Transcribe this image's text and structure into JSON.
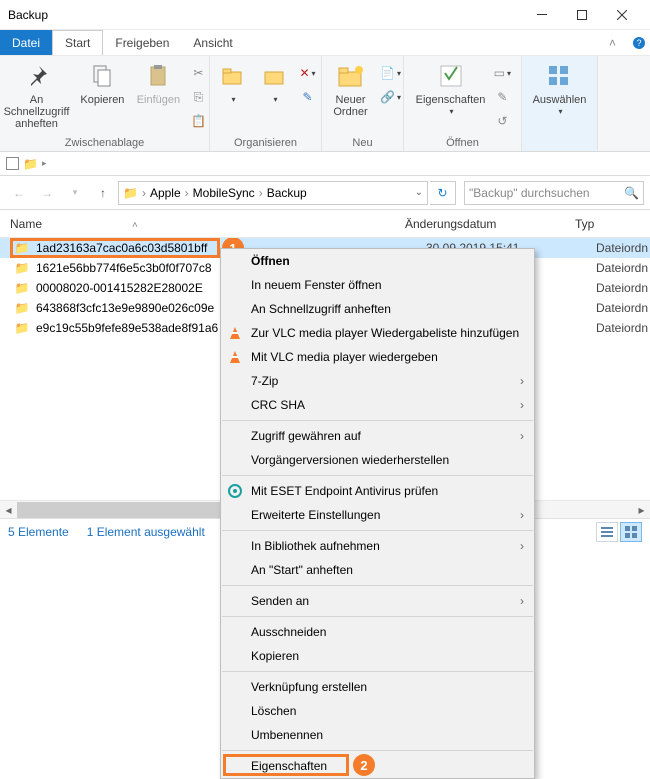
{
  "window": {
    "title": "Backup"
  },
  "menubar": {
    "file": "Datei",
    "tabs": [
      "Start",
      "Freigeben",
      "Ansicht"
    ]
  },
  "ribbon": {
    "groups": [
      {
        "label": "Zwischenablage",
        "buttons": [
          {
            "label": "An Schnellzugriff\nanheften",
            "icon": "pin-icon",
            "dim": false
          },
          {
            "label": "Kopieren",
            "icon": "copy-icon",
            "dim": false
          },
          {
            "label": "Einfügen",
            "icon": "paste-icon",
            "dim": true
          }
        ]
      },
      {
        "label": "Organisieren",
        "buttons": [
          {
            "label": "",
            "icon": "moveto-icon"
          },
          {
            "label": "",
            "icon": "delete-icon"
          }
        ]
      },
      {
        "label": "Neu",
        "buttons": [
          {
            "label": "Neuer\nOrdner",
            "icon": "new-folder-icon"
          }
        ]
      },
      {
        "label": "Öffnen",
        "buttons": [
          {
            "label": "Eigenschaften",
            "icon": "properties-icon"
          }
        ]
      },
      {
        "label": "",
        "buttons": [
          {
            "label": "Auswählen",
            "icon": "select-icon"
          }
        ]
      }
    ]
  },
  "breadcrumb": {
    "parts": [
      "Apple",
      "MobileSync",
      "Backup"
    ]
  },
  "search": {
    "placeholder": "\"Backup\" durchsuchen"
  },
  "columns": {
    "name": "Name",
    "date": "Änderungsdatum",
    "type": "Typ"
  },
  "rows": [
    {
      "name": "1ad23163a7cac0a6c03d5801bff",
      "date": "30.09.2019 15:41",
      "type": "Dateiordn"
    },
    {
      "name": "1621e56bb774f6e5c3b0f0f707c8",
      "date": "",
      "type": "Dateiordn"
    },
    {
      "name": "00008020-001415282E28002E",
      "date": "",
      "type": "Dateiordn"
    },
    {
      "name": "643868f3cfc13e9e9890e026c09e",
      "date": "",
      "type": "Dateiordn"
    },
    {
      "name": "e9c19c55b9fefe89e538ade8f91a6",
      "date": "",
      "type": "Dateiordn"
    }
  ],
  "context_menu": [
    {
      "label": "Öffnen",
      "top": true
    },
    {
      "label": "In neuem Fenster öffnen"
    },
    {
      "label": "An Schnellzugriff anheften"
    },
    {
      "label": "Zur VLC media player Wiedergabeliste hinzufügen",
      "icon": "vlc-icon"
    },
    {
      "label": "Mit VLC media player wiedergeben",
      "icon": "vlc-icon"
    },
    {
      "label": "7-Zip",
      "sub": true
    },
    {
      "label": "CRC SHA",
      "sub": true
    },
    {
      "sep": true
    },
    {
      "label": "Zugriff gewähren auf",
      "sub": true
    },
    {
      "label": "Vorgängerversionen wiederherstellen"
    },
    {
      "sep": true
    },
    {
      "label": "Mit ESET Endpoint Antivirus prüfen",
      "icon": "eset-icon"
    },
    {
      "label": "Erweiterte Einstellungen",
      "sub": true
    },
    {
      "sep": true
    },
    {
      "label": "In Bibliothek aufnehmen",
      "sub": true
    },
    {
      "label": "An \"Start\" anheften"
    },
    {
      "sep": true
    },
    {
      "label": "Senden an",
      "sub": true
    },
    {
      "sep": true
    },
    {
      "label": "Ausschneiden"
    },
    {
      "label": "Kopieren"
    },
    {
      "sep": true
    },
    {
      "label": "Verknüpfung erstellen"
    },
    {
      "label": "Löschen"
    },
    {
      "label": "Umbenennen"
    },
    {
      "sep": true
    },
    {
      "label": "Eigenschaften",
      "hl": true
    }
  ],
  "status": {
    "count": "5 Elemente",
    "selected": "1 Element ausgewählt"
  },
  "annotations": {
    "badge1": "1",
    "badge2": "2"
  }
}
